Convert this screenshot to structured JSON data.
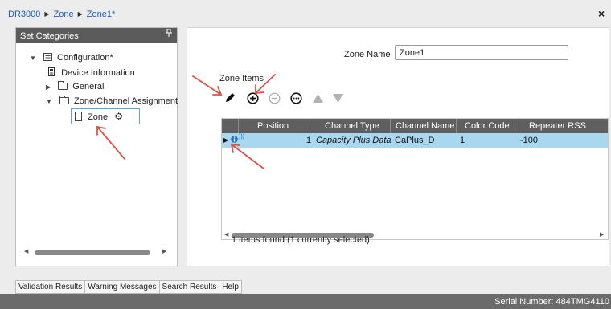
{
  "breadcrumb": [
    "DR3000",
    "Zone",
    "Zone1*"
  ],
  "close_glyph": "×",
  "left_panel": {
    "title": "Set Categories",
    "pin_glyph": "ᵖ",
    "tree": {
      "root": "Configuration*",
      "device_info": "Device Information",
      "general": "General",
      "zone_channel": "Zone/Channel Assignment",
      "zone": "Zone"
    }
  },
  "zone_form": {
    "name_label": "Zone Name",
    "name_value": "Zone1",
    "items_label": "Zone Items"
  },
  "toolbar_icons": [
    "edit-icon",
    "add-icon",
    "remove-icon",
    "more-icon",
    "move-up-icon",
    "move-down-icon"
  ],
  "grid": {
    "columns": [
      "Position",
      "Channel Type",
      "Channel Name",
      "Color Code",
      "Repeater RSS"
    ],
    "rows": [
      {
        "position": "1",
        "channel_type": "Capacity Plus Data",
        "channel_name": "CaPlus_D",
        "color_code": "1",
        "repeater_rss": "-100"
      }
    ],
    "status": "1 items found (1 currently selected)."
  },
  "bottom_tabs": [
    "Validation Results",
    "Warning Messages",
    "Search Results",
    "Help"
  ],
  "serial": "Serial Number: 484TMG4110",
  "colors": {
    "accent_link": "#1a5fb4",
    "header_gray": "#5f5f5f",
    "selection": "#a9d7ef",
    "arrow_red": "#e0504a"
  }
}
